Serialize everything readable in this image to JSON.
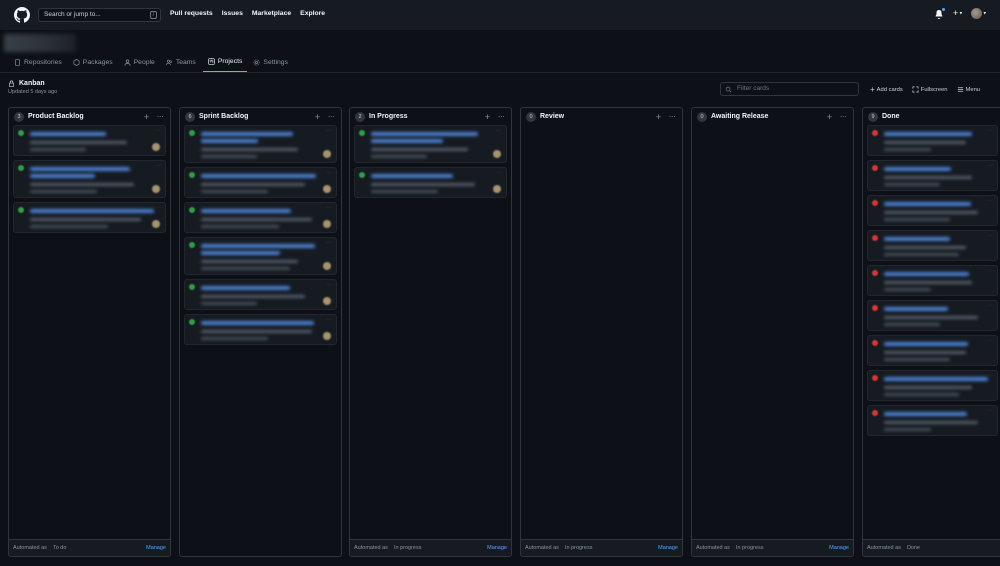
{
  "header": {
    "search_placeholder": "Search or jump to...",
    "search_shortcut": "/",
    "nav": [
      "Pull requests",
      "Issues",
      "Marketplace",
      "Explore"
    ],
    "plus_icon": "plus-icon",
    "bell_icon": "bell-icon"
  },
  "org_tabs": [
    {
      "label": "Repositories",
      "icon": "repo-icon"
    },
    {
      "label": "Packages",
      "icon": "package-icon"
    },
    {
      "label": "People",
      "icon": "person-icon"
    },
    {
      "label": "Teams",
      "icon": "people-icon"
    },
    {
      "label": "Projects",
      "icon": "project-icon",
      "active": true
    },
    {
      "label": "Settings",
      "icon": "gear-icon"
    }
  ],
  "project": {
    "title": "Kanban",
    "updated": "Updated 5 days ago",
    "filter_placeholder": "Filter cards",
    "actions": [
      "Add cards",
      "Fullscreen",
      "Menu"
    ]
  },
  "colors": {
    "accent_tab": "#f78166",
    "link": "#58a6ff",
    "open_issue": "#2ea043",
    "closed_issue": "#da3633"
  },
  "columns": [
    {
      "count": "3",
      "name": "Product Backlog",
      "automated_label": "Automated as",
      "automated_value": "To do",
      "manage": "Manage",
      "card_count": 3
    },
    {
      "count": "6",
      "name": "Sprint Backlog",
      "automated_label": "",
      "automated_value": "",
      "manage": "",
      "card_count": 6
    },
    {
      "count": "2",
      "name": "In Progress",
      "automated_label": "Automated as",
      "automated_value": "In progress",
      "manage": "Manage",
      "card_count": 2
    },
    {
      "count": "0",
      "name": "Review",
      "automated_label": "Automated as",
      "automated_value": "In progress",
      "manage": "Manage",
      "card_count": 0
    },
    {
      "count": "0",
      "name": "Awaiting Release",
      "automated_label": "Automated as",
      "automated_value": "In progress",
      "manage": "Manage",
      "card_count": 0
    },
    {
      "count": "9",
      "name": "Done",
      "automated_label": "Automated as",
      "automated_value": "Done",
      "manage": "",
      "card_count": 9
    }
  ]
}
